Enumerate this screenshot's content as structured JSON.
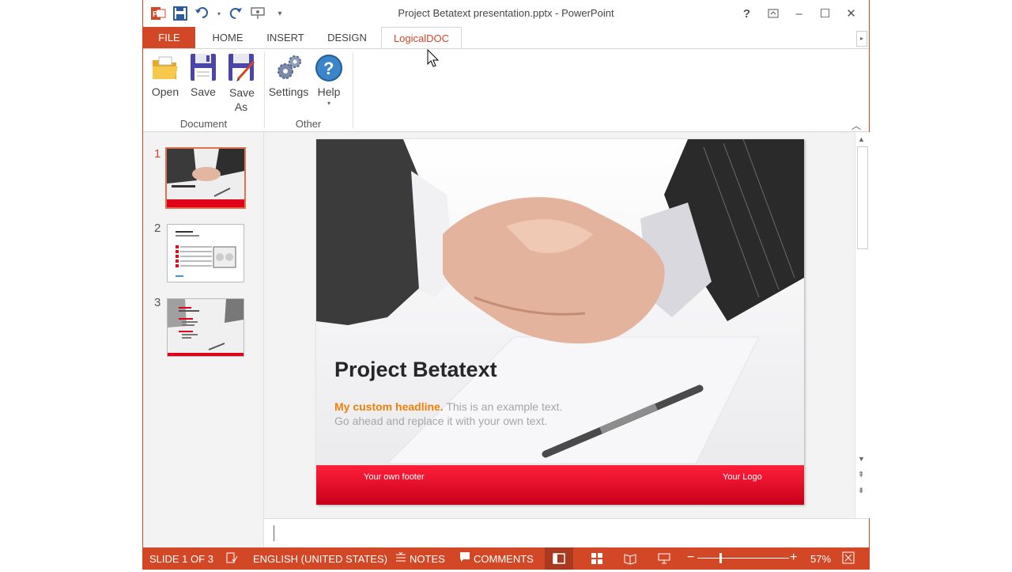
{
  "window": {
    "title": "Project Betatext presentation.pptx - PowerPoint",
    "controls": {
      "help": "?",
      "minimize": "–",
      "maximize": "☐",
      "close": "✕"
    }
  },
  "tabs": [
    {
      "label": "FILE"
    },
    {
      "label": "HOME"
    },
    {
      "label": "INSERT"
    },
    {
      "label": "DESIGN"
    },
    {
      "label": "LogicalDOC"
    }
  ],
  "ribbon": {
    "groups": [
      {
        "label": "Document",
        "buttons": [
          {
            "label": "Open"
          },
          {
            "label": "Save"
          },
          {
            "label": "Save As"
          }
        ]
      },
      {
        "label": "Other",
        "buttons": [
          {
            "label": "Settings"
          },
          {
            "label": "Help"
          }
        ]
      }
    ]
  },
  "thumbnails": [
    {
      "number": "1",
      "title": "Project Betatext"
    },
    {
      "number": "2",
      "title": "Example headline"
    },
    {
      "number": "3",
      "title": "Example"
    }
  ],
  "slide": {
    "title": "Project Betatext",
    "headline": "My custom headline.",
    "body_line1": "This is an example text.",
    "body_line2": "Go ahead and replace it with your own text.",
    "footer_left": "Your own footer",
    "footer_right": "Your Logo"
  },
  "status": {
    "slide_info": "SLIDE 1 OF 3",
    "language": "ENGLISH (UNITED STATES)",
    "notes": "NOTES",
    "comments": "COMMENTS",
    "zoom": "57%"
  },
  "colors": {
    "accent": "#d24726",
    "headline": "#f07f09",
    "footer": "#e1001a"
  }
}
